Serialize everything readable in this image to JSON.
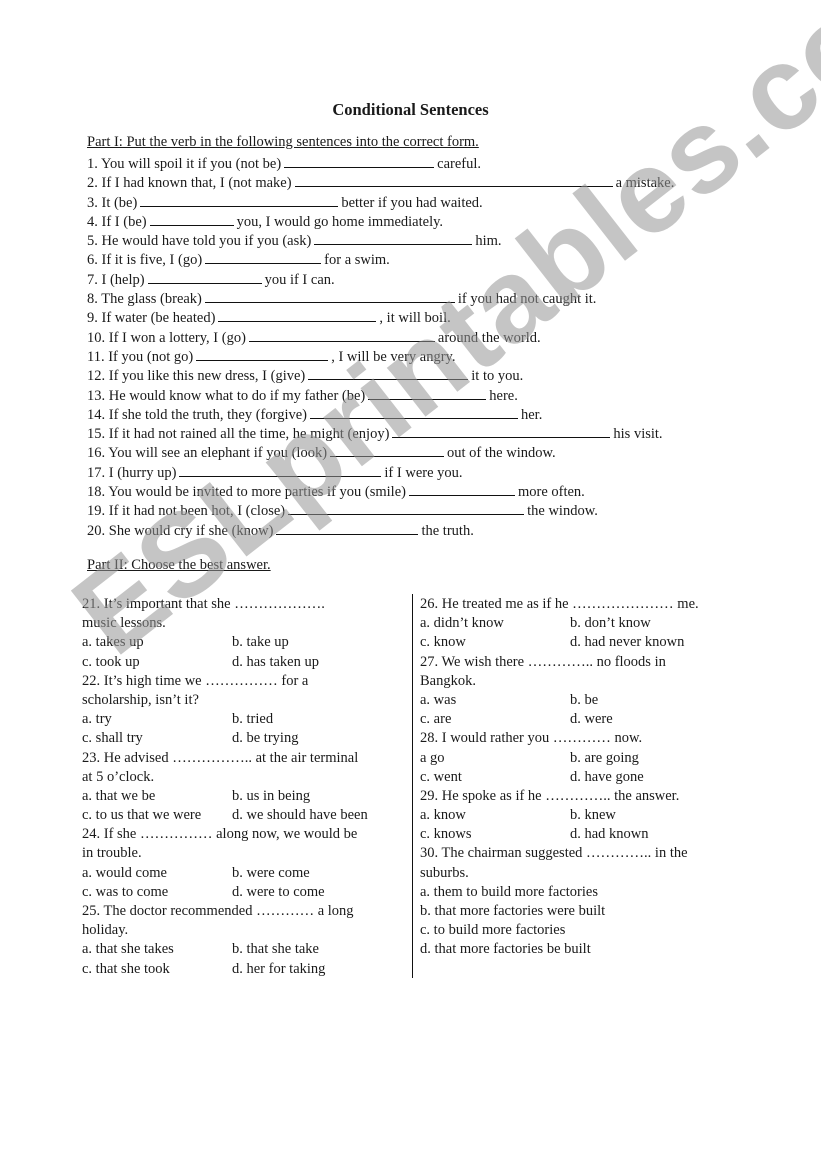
{
  "document": {
    "title": "Conditional Sentences",
    "watermark": "ESLprintables.com"
  },
  "part1": {
    "heading": "Part I: Put the verb in the following sentences into the correct form.",
    "items": [
      {
        "before": "1. You will spoil it if you (not be)",
        "after": "careful."
      },
      {
        "before": "2. If I had known that, I (not make)",
        "after": "a mistake."
      },
      {
        "before": "3. It (be)",
        "after": "better if you had waited."
      },
      {
        "before": "4. If I (be)",
        "after": "you, I would go home immediately."
      },
      {
        "before": "5. He would have told you if you (ask)",
        "after": "him."
      },
      {
        "before": "6. If it is five, I (go)",
        "after": "for a swim."
      },
      {
        "before": "7. I (help)",
        "after": "you if I can."
      },
      {
        "before": "8. The glass (break)",
        "after": "if you had not caught it."
      },
      {
        "before": "9. If water (be heated)",
        "after": ", it will boil."
      },
      {
        "before": "10. If I won a lottery, I (go)",
        "after": "around the world."
      },
      {
        "before": "11. If you (not go)",
        "after": ", I will be very angry."
      },
      {
        "before": "12. If you like this new dress, I (give)",
        "after": "it to you."
      },
      {
        "before": "13. He would know  what to do if my father (be)",
        "after": "here."
      },
      {
        "before": "14. If she told the truth, they (forgive)",
        "after": "her."
      },
      {
        "before": "15. If it had not rained all the time, he might (enjoy)",
        "after": "his visit."
      },
      {
        "before": "16. You will see an elephant if you (look)",
        "after": "out of the window."
      },
      {
        "before": "17. I (hurry up)",
        "after": "if I were you."
      },
      {
        "before": "18. You would be invited to more parties if you (smile)",
        "after": "more often."
      },
      {
        "before": "19. If it had not been hot, I (close)",
        "after": "the window."
      },
      {
        "before": "20. She would cry if she (know)",
        "after": "the truth."
      }
    ]
  },
  "part2": {
    "heading": "Part II: Choose the best answer.",
    "left": [
      {
        "question": [
          "21. It’s important that she ……………….",
          "music lessons."
        ],
        "options": [
          [
            "a. takes up",
            "b. take up"
          ],
          [
            "c. took up",
            "d. has taken up"
          ]
        ]
      },
      {
        "question": [
          "22. It’s high time we …………… for a",
          "scholarship, isn’t it?"
        ],
        "options": [
          [
            "a. try",
            "b. tried"
          ],
          [
            "c. shall try",
            "d. be trying"
          ]
        ]
      },
      {
        "question": [
          "23. He advised …………….. at the air terminal",
          "at 5 o’clock."
        ],
        "options": [
          [
            "a. that we be",
            "b. us in being"
          ],
          [
            "c. to us that we were",
            "d.  we should have been"
          ]
        ]
      },
      {
        "question": [
          "24. If she …………… along now, we would be",
          "in trouble."
        ],
        "options": [
          [
            "a. would come",
            "b. were come"
          ],
          [
            "c. was to come",
            "d. were to come"
          ]
        ]
      },
      {
        "question": [
          "25. The doctor recommended ………… a long",
          "holiday."
        ],
        "options": [
          [
            "a. that she takes",
            "b. that she take"
          ],
          [
            "c. that she took",
            "d. her for taking"
          ]
        ]
      }
    ],
    "right": [
      {
        "question": [
          "26. He treated me as if he ………………… me."
        ],
        "options": [
          [
            "a. didn’t know",
            "b. don’t know"
          ],
          [
            "c. know",
            "d. had never known"
          ]
        ]
      },
      {
        "question": [
          "27. We wish there ………….. no floods in",
          "Bangkok."
        ],
        "options": [
          [
            "a. was",
            "b. be"
          ],
          [
            "c. are",
            "d. were"
          ]
        ]
      },
      {
        "question": [
          "28. I would rather you ………… now."
        ],
        "options": [
          [
            "a go",
            "b. are going"
          ],
          [
            "c. went",
            "d. have gone"
          ]
        ]
      },
      {
        "question": [
          "29. He spoke as if he ………….. the answer."
        ],
        "options": [
          [
            "a. know",
            "b. knew"
          ],
          [
            "c. knows",
            "d. had known"
          ]
        ]
      },
      {
        "question": [
          "30. The chairman suggested ………….. in the",
          "suburbs."
        ],
        "options": [
          [
            "a. them to build more factories"
          ],
          [
            "b. that more factories were built"
          ],
          [
            "c. to build more factories"
          ],
          [
            "d. that more factories be built"
          ]
        ]
      }
    ]
  }
}
